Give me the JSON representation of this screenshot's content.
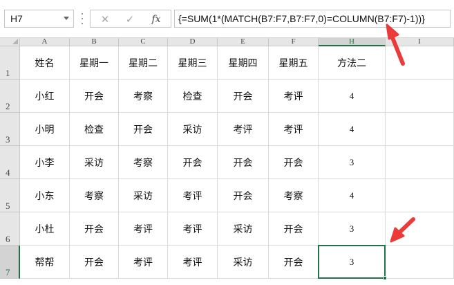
{
  "formula_bar": {
    "name_box": "H7",
    "cancel_icon": "✕",
    "enter_icon": "✓",
    "fx_label": "fx",
    "formula": "{=SUM(1*(MATCH(B7:F7,B7:F7,0)=COLUMN(B7:F7)-1))}"
  },
  "columns": [
    "A",
    "B",
    "C",
    "D",
    "E",
    "F",
    "H",
    "I"
  ],
  "active_column": "H",
  "rows": [
    "1",
    "2",
    "3",
    "4",
    "5",
    "6",
    "7"
  ],
  "active_row": "7",
  "table": [
    [
      "姓名",
      "星期一",
      "星期二",
      "星期三",
      "星期四",
      "星期五",
      "方法二",
      ""
    ],
    [
      "小红",
      "开会",
      "考察",
      "检查",
      "开会",
      "考评",
      "4",
      ""
    ],
    [
      "小明",
      "检查",
      "开会",
      "采访",
      "考评",
      "考评",
      "4",
      ""
    ],
    [
      "小李",
      "采访",
      "考察",
      "开会",
      "开会",
      "开会",
      "3",
      ""
    ],
    [
      "小东",
      "考察",
      "采访",
      "考评",
      "开会",
      "考察",
      "4",
      ""
    ],
    [
      "小杜",
      "开会",
      "考评",
      "考评",
      "采访",
      "开会",
      "3",
      ""
    ],
    [
      "帮帮",
      "开会",
      "考评",
      "考评",
      "采访",
      "开会",
      "3",
      ""
    ]
  ],
  "selected_cell": "H7",
  "colors": {
    "accent": "#217346",
    "arrow": "#ea3a3a"
  },
  "annotations": [
    "arrow-to-formula",
    "arrow-to-selected-cell"
  ]
}
